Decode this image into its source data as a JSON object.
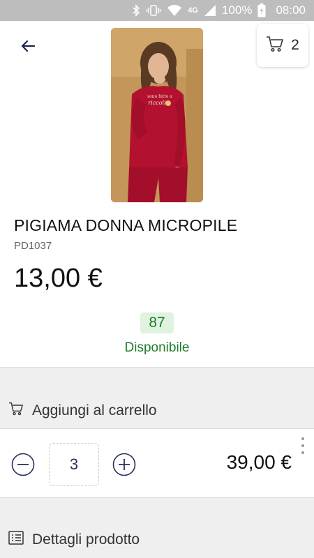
{
  "status_bar": {
    "network": "4G",
    "battery": "100%",
    "time": "08:00"
  },
  "header": {
    "cart_count": "2"
  },
  "product": {
    "title": "PIGIAMA DONNA MICROPILE",
    "sku": "PD1037",
    "price": "13,00 €",
    "stock_count": "87",
    "stock_label": "Disponibile",
    "image_print_text": "sono fatto a riccoli"
  },
  "add_to_cart": {
    "label": "Aggiungi al carrello",
    "quantity": "3",
    "line_total": "39,00 €"
  },
  "details": {
    "label": "Dettagli prodotto"
  },
  "colors": {
    "accent": "#2a2f5a",
    "available_green": "#1e7d2a",
    "available_bg": "#dff3df",
    "pajama_red": "#b3112f"
  },
  "icons": [
    "bluetooth-icon",
    "vibrate-icon",
    "wifi-icon",
    "signal-icon",
    "battery-icon",
    "back-arrow-icon",
    "cart-icon",
    "minus-circle-icon",
    "plus-circle-icon",
    "more-vertical-icon",
    "list-icon"
  ]
}
